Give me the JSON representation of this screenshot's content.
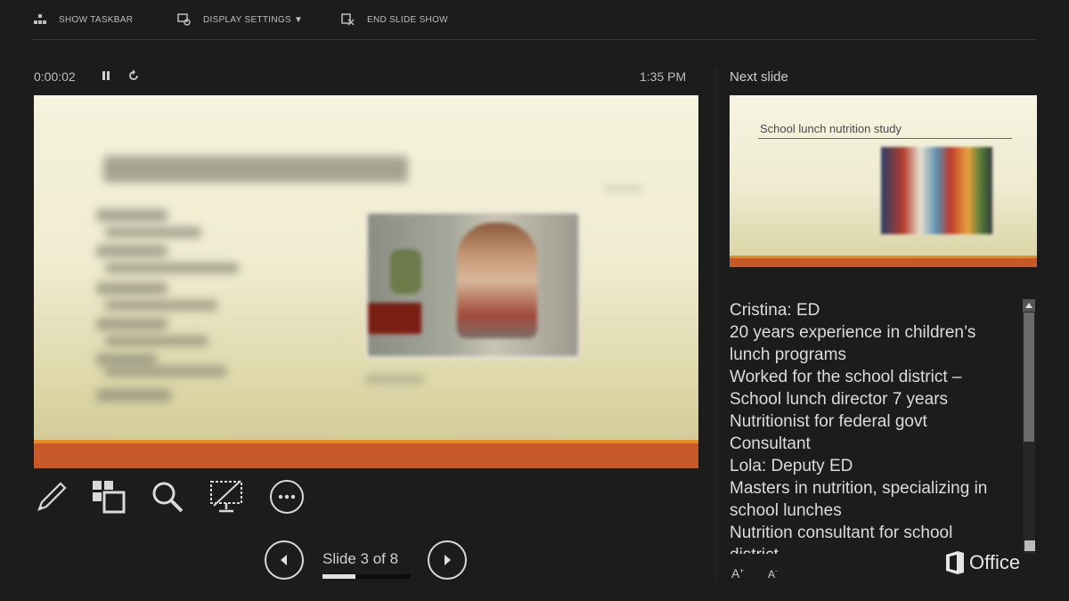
{
  "toolbar": {
    "show_taskbar": "SHOW TASKBAR",
    "display_settings": "DISPLAY SETTINGS ▼",
    "end_slide_show": "END SLIDE SHOW"
  },
  "status": {
    "timer": "0:00:02",
    "clock": "1:35 PM"
  },
  "navigation": {
    "slide_counter": "Slide 3 of 8",
    "progress_fraction": 0.375
  },
  "next_slide": {
    "label": "Next slide",
    "title": "School lunch nutrition study"
  },
  "notes": [
    "Cristina: ED",
    "20 years experience in children’s",
    "lunch programs",
    "Worked for the school district –",
    "School lunch director 7 years",
    "Nutritionist for federal govt",
    "Consultant",
    "Lola: Deputy ED",
    "Masters in nutrition, specializing in",
    "school lunches",
    "Nutrition consultant for school",
    "district"
  ],
  "font_controls": {
    "increase": "A",
    "decrease": "A"
  },
  "branding": {
    "office": "Office"
  },
  "icons": {
    "pen": "pen-icon",
    "see_all_slides": "grid-icon",
    "zoom": "magnifier-icon",
    "black_screen": "screen-off-icon",
    "more": "more-options-icon"
  },
  "colors": {
    "background": "#1c1c1c",
    "slide_accent": "#c85a2a",
    "slide_accent_line": "#e98a21"
  }
}
